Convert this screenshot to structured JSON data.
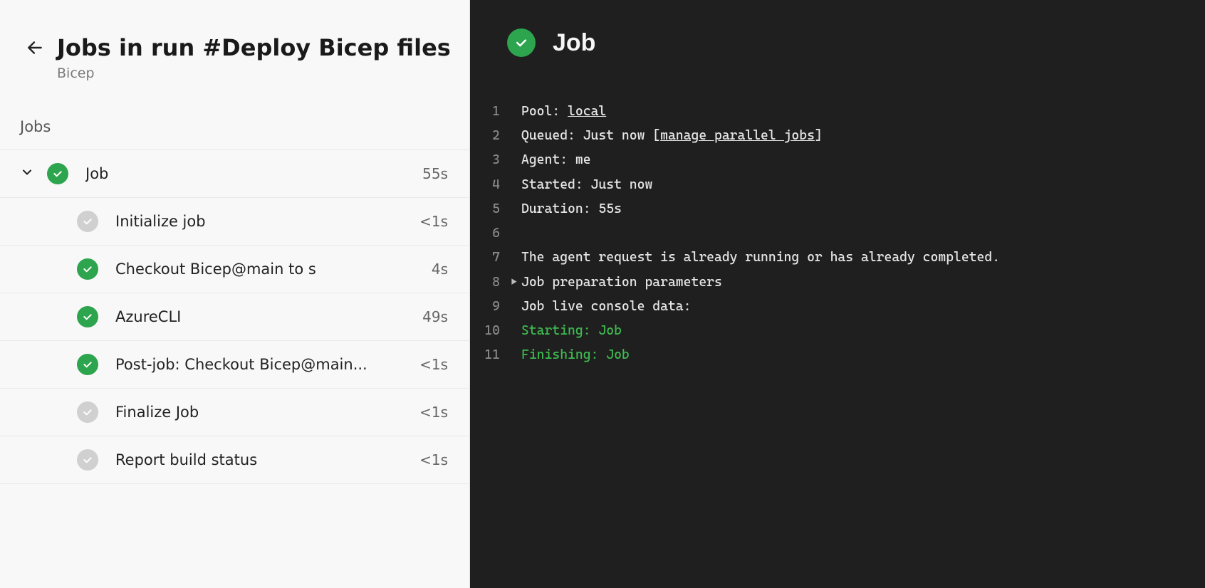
{
  "header": {
    "title": "Jobs in run #Deploy Bicep files",
    "subtitle": "Bicep"
  },
  "section_heading": "Jobs",
  "parent_job": {
    "label": "Job",
    "duration": "55s"
  },
  "steps": [
    {
      "label": "Initialize job",
      "duration": "<1s",
      "status": "grey"
    },
    {
      "label": "Checkout Bicep@main to s",
      "duration": "4s",
      "status": "green"
    },
    {
      "label": "AzureCLI",
      "duration": "49s",
      "status": "green"
    },
    {
      "label": "Post-job: Checkout Bicep@main...",
      "duration": "<1s",
      "status": "green"
    },
    {
      "label": "Finalize Job",
      "duration": "<1s",
      "status": "grey"
    },
    {
      "label": "Report build status",
      "duration": "<1s",
      "status": "grey"
    }
  ],
  "details": {
    "title": "Job",
    "pool_label": "Pool: ",
    "pool_value": "local",
    "queued_label": "Queued: Just now [",
    "queued_link": "manage parallel jobs",
    "queued_after": "]",
    "agent": "Agent: me",
    "started": "Started: Just now",
    "duration": "Duration: 55s",
    "blank": "",
    "msg": "The agent request is already running or has already completed.",
    "prep": "Job preparation parameters",
    "live": "Job live console data:",
    "starting": "Starting: Job",
    "finishing": "Finishing: Job"
  }
}
